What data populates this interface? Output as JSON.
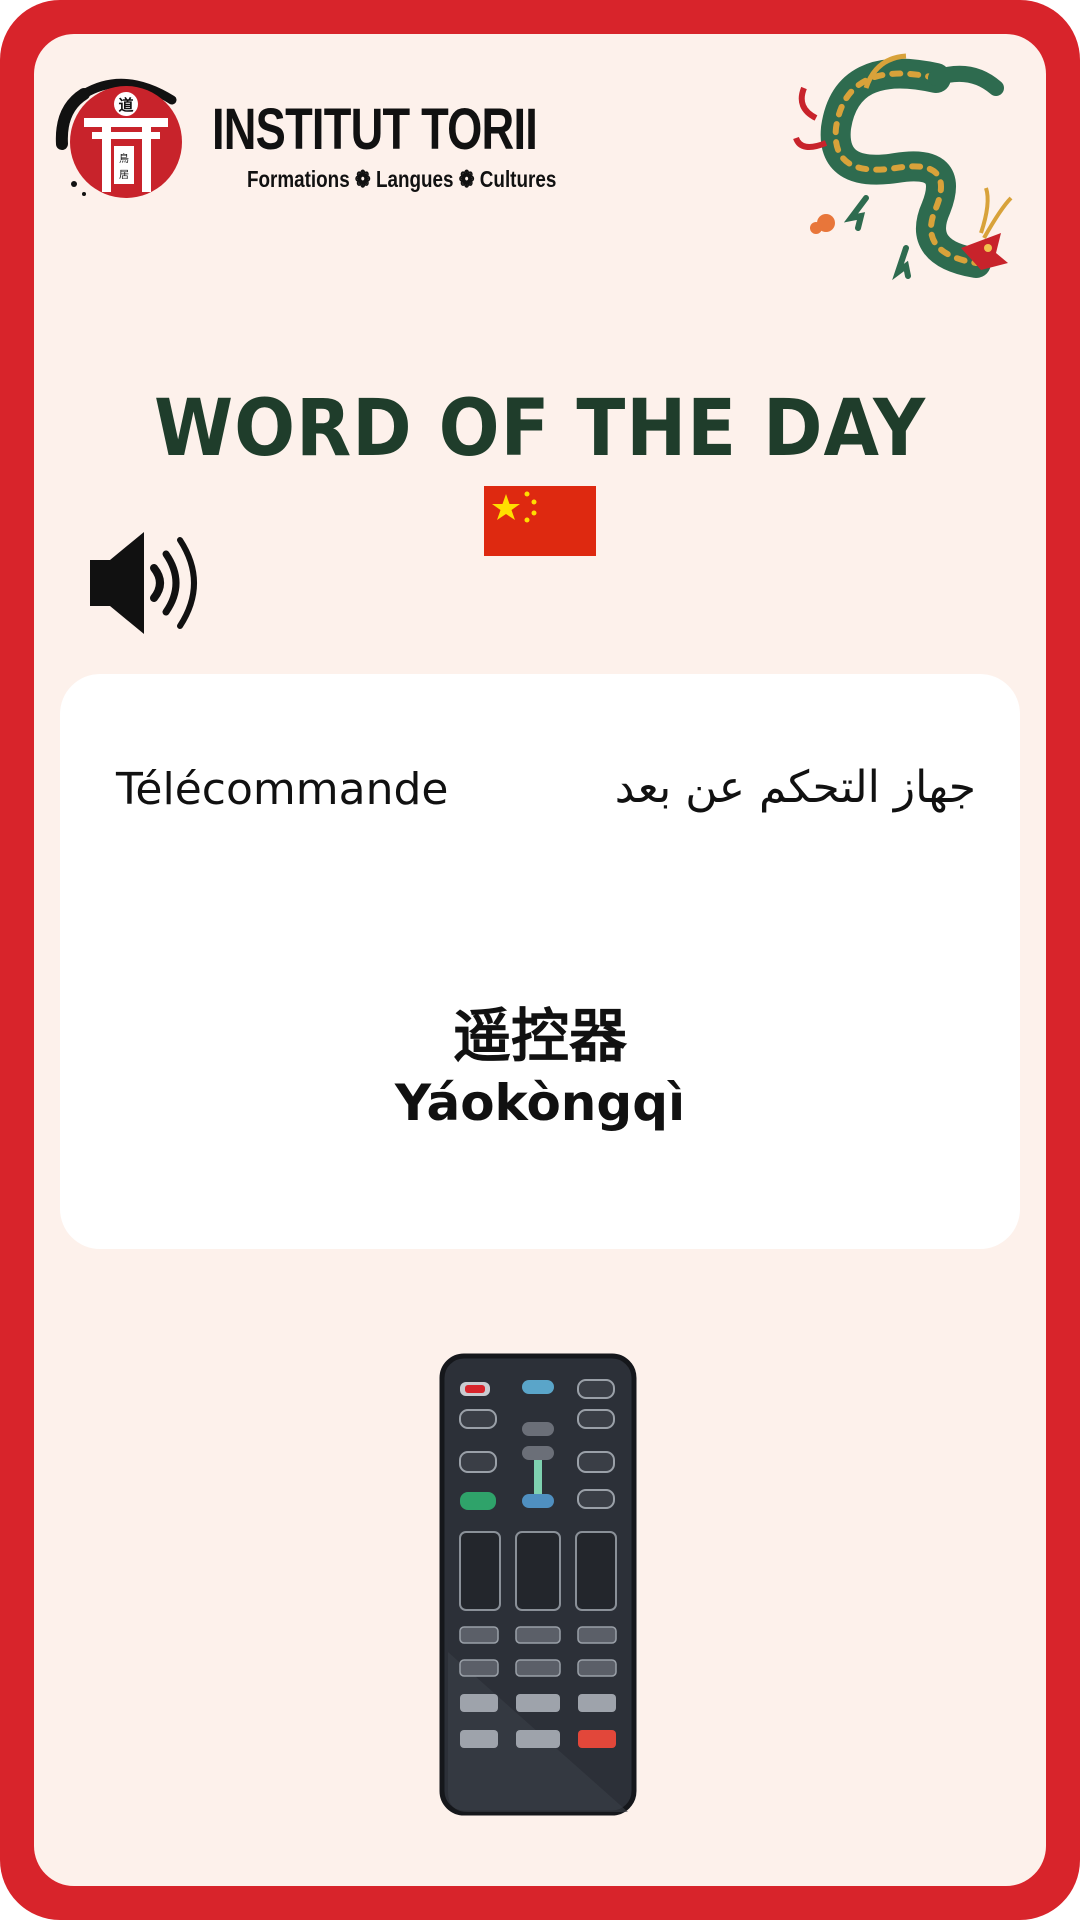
{
  "brand": {
    "name": "INSTITUT TORII",
    "tagline": "Formations ❁ Langues ❁ Cultures",
    "logo_glyph_top": "道",
    "logo_glyph_side": "鳥居",
    "colors": {
      "red": "#d8242b",
      "cream": "#fdf1eb",
      "title_green": "#1f3d2b"
    }
  },
  "header": {
    "title": "WORD OF THE DAY"
  },
  "icons": {
    "flag": "china-flag-icon",
    "audio": "speaker-icon",
    "decor": "dragon-icon",
    "illustration": "remote-control-icon"
  },
  "word": {
    "french": "Télécommande",
    "arabic": "جهاز التحكم عن بعد",
    "chinese": "遥控器",
    "pinyin": "Yáokòngqì"
  }
}
